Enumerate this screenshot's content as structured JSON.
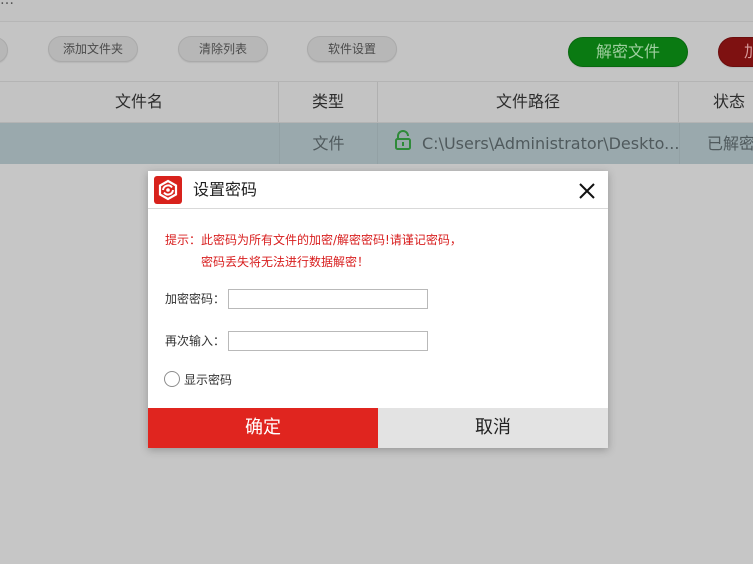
{
  "app": {
    "title_partial": "…",
    "toolbar": {
      "add_folder": "添加文件夹",
      "clear_list": "清除列表",
      "software_settings": "软件设置",
      "decrypt_file": "解密文件",
      "encrypt_partial": "加"
    },
    "table": {
      "headers": {
        "name": "文件名",
        "type": "类型",
        "path": "文件路径",
        "status": "状态"
      },
      "rows": [
        {
          "name": "",
          "type": "文件",
          "path": "C:\\Users\\Administrator\\Deskto...",
          "status": "已解密"
        }
      ]
    }
  },
  "dialog": {
    "title": "设置密码",
    "hint_line1": "提示：此密码为所有文件的加密/解密密码!请谨记密码，",
    "hint_line2": "密码丢失将无法进行数据解密！",
    "password_label": "加密密码：",
    "password_value": "",
    "confirm_label": "再次输入：",
    "confirm_value": "",
    "show_password_label": "显示密码",
    "ok_label": "确定",
    "cancel_label": "取消"
  },
  "colors": {
    "accent_red": "#e0251f",
    "hint_red": "#d81e1e",
    "decrypt_green": "#0a7a12",
    "lock_green": "#2f8a3a"
  },
  "icons": {
    "logo": "app-logo-icon",
    "close": "close-icon",
    "lock": "unlock-icon"
  }
}
